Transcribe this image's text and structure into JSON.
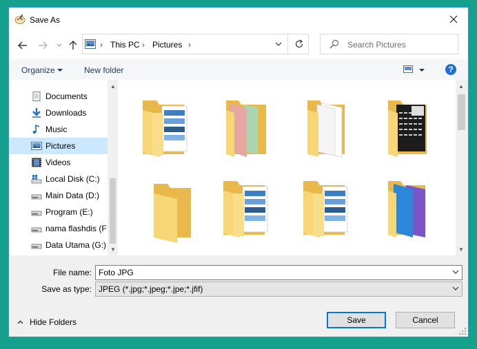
{
  "window": {
    "title": "Save As"
  },
  "nav": {
    "breadcrumbs": [
      "This PC",
      "Pictures"
    ],
    "search_placeholder": "Search Pictures"
  },
  "toolbar": {
    "organize": "Organize",
    "new_folder": "New folder",
    "help": "?"
  },
  "sidebar": {
    "items": [
      {
        "label": "Documents",
        "icon": "documents-icon"
      },
      {
        "label": "Downloads",
        "icon": "downloads-icon"
      },
      {
        "label": "Music",
        "icon": "music-icon"
      },
      {
        "label": "Pictures",
        "icon": "pictures-icon",
        "selected": true
      },
      {
        "label": "Videos",
        "icon": "videos-icon"
      },
      {
        "label": "Local Disk (C:)",
        "icon": "system-drive-icon"
      },
      {
        "label": "Main Data (D:)",
        "icon": "drive-icon"
      },
      {
        "label": "Program (E:)",
        "icon": "drive-icon"
      },
      {
        "label": "nama flashdis (F:",
        "icon": "usb-drive-icon"
      },
      {
        "label": "Data Utama (G:)",
        "icon": "drive-icon"
      }
    ]
  },
  "folders": [
    {
      "icon": "folder-with-images-icon"
    },
    {
      "icon": "folder-with-colored-sheets-icon"
    },
    {
      "icon": "folder-with-documents-icon"
    },
    {
      "icon": "folder-with-keyboard-photo-icon"
    },
    {
      "icon": "empty-folder-icon"
    },
    {
      "icon": "folder-with-images-icon"
    },
    {
      "icon": "folder-with-images-icon"
    },
    {
      "icon": "folder-with-blue-purple-sheets-icon"
    }
  ],
  "form": {
    "file_name_label": "File name:",
    "file_name_value": "Foto JPG",
    "save_type_label": "Save as type:",
    "save_type_value": "JPEG (*.jpg;*.jpeg;*.jpe;*.jfif)"
  },
  "footer": {
    "hide_folders": "Hide Folders",
    "save": "Save",
    "cancel": "Cancel"
  },
  "colors": {
    "background": "#14a08c",
    "selection": "#cce8ff",
    "accent": "#0078d7",
    "folder": "#f7d675"
  }
}
